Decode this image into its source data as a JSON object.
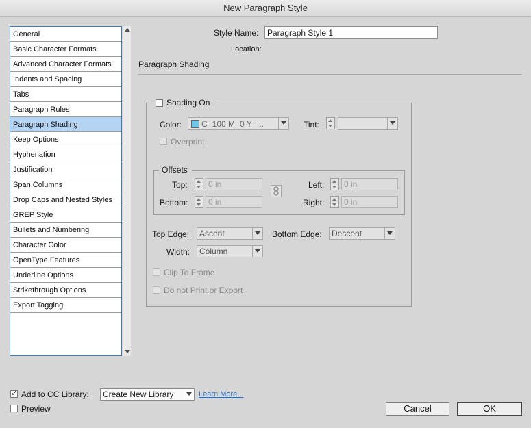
{
  "window": {
    "title": "New Paragraph Style"
  },
  "categories": [
    "General",
    "Basic Character Formats",
    "Advanced Character Formats",
    "Indents and Spacing",
    "Tabs",
    "Paragraph Rules",
    "Paragraph Shading",
    "Keep Options",
    "Hyphenation",
    "Justification",
    "Span Columns",
    "Drop Caps and Nested Styles",
    "GREP Style",
    "Bullets and Numbering",
    "Character Color",
    "OpenType Features",
    "Underline Options",
    "Strikethrough Options",
    "Export Tagging"
  ],
  "selected_category": "Paragraph Shading",
  "header": {
    "style_name_label": "Style Name:",
    "style_name_value": "Paragraph Style 1",
    "location_label": "Location:",
    "section_title": "Paragraph Shading"
  },
  "shading": {
    "shading_on_label": "Shading On",
    "shading_on_checked": false,
    "color_label": "Color:",
    "color_value": "C=100 M=0 Y=...",
    "color_swatch": "#6ec6ea",
    "tint_label": "Tint:",
    "tint_value": "",
    "overprint_label": "Overprint",
    "offsets_label": "Offsets",
    "top_label": "Top:",
    "top_value": "0 in",
    "bottom_label": "Bottom:",
    "bottom_value": "0 in",
    "left_label": "Left:",
    "left_value": "0 in",
    "right_label": "Right:",
    "right_value": "0 in",
    "top_edge_label": "Top Edge:",
    "top_edge_value": "Ascent",
    "bottom_edge_label": "Bottom Edge:",
    "bottom_edge_value": "Descent",
    "width_label": "Width:",
    "width_value": "Column",
    "clip_label": "Clip To Frame",
    "no_print_label": "Do not Print or Export"
  },
  "footer": {
    "add_cc_label": "Add to CC Library:",
    "add_cc_checked": true,
    "library_value": "Create New Library",
    "learn_more": "Learn More...",
    "preview_label": "Preview",
    "preview_checked": false,
    "cancel_label": "Cancel",
    "ok_label": "OK"
  }
}
